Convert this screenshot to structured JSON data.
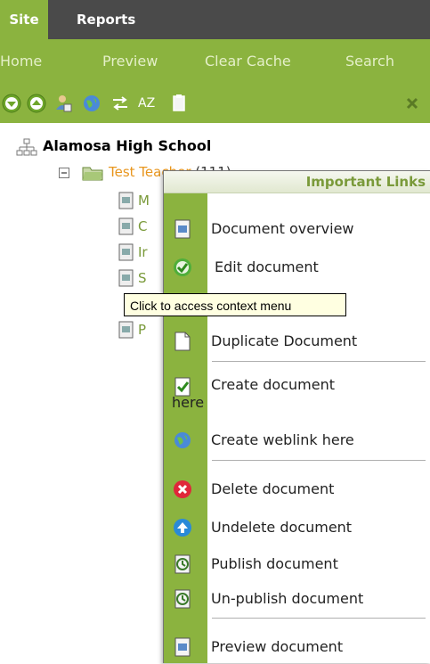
{
  "top_tabs": [
    "Site",
    "Reports"
  ],
  "nav_links": [
    "Home",
    "Preview",
    "Clear Cache",
    "Search"
  ],
  "toolbar_icons": [
    "expand-all-icon",
    "collapse-all-icon",
    "person-icon",
    "globe-icon",
    "swap-icon",
    "az-sort-icon",
    "clipboard-icon",
    "close-icon"
  ],
  "toolbar_sort_text": "AZ",
  "tree": {
    "root_label": "Alamosa High School",
    "child_label": "Test Teacher",
    "child_count": "(111)",
    "leaves": [
      "M",
      "C",
      "Ir",
      "S",
      "",
      "P"
    ]
  },
  "context_menu": {
    "title": "Important Links",
    "items": [
      {
        "label": "Document overview",
        "icon": "document-icon"
      },
      {
        "label": "Edit document",
        "icon": "checkmark-icon"
      },
      {
        "label": "",
        "icon": "copy-icon"
      },
      {
        "label": "Duplicate Document",
        "icon": "page-icon"
      },
      {
        "label": "Create document",
        "label2": "here",
        "icon": "new-document-icon"
      },
      {
        "label": "Create weblink here",
        "icon": "globe-icon"
      },
      {
        "label": "Delete document",
        "icon": "delete-icon"
      },
      {
        "label": "Undelete document",
        "icon": "undelete-icon"
      },
      {
        "label": "Publish document",
        "icon": "publish-icon"
      },
      {
        "label": "Un-publish document",
        "icon": "unpublish-icon"
      },
      {
        "label": "Preview document",
        "icon": "preview-icon"
      }
    ]
  },
  "tooltip": "Click to access context menu",
  "colors": {
    "accent": "#8bb33f",
    "topbar": "#4a4a4a",
    "nav_text": "#e4efc8",
    "link_text": "#7a9a3a",
    "orange": "#e8961e"
  }
}
